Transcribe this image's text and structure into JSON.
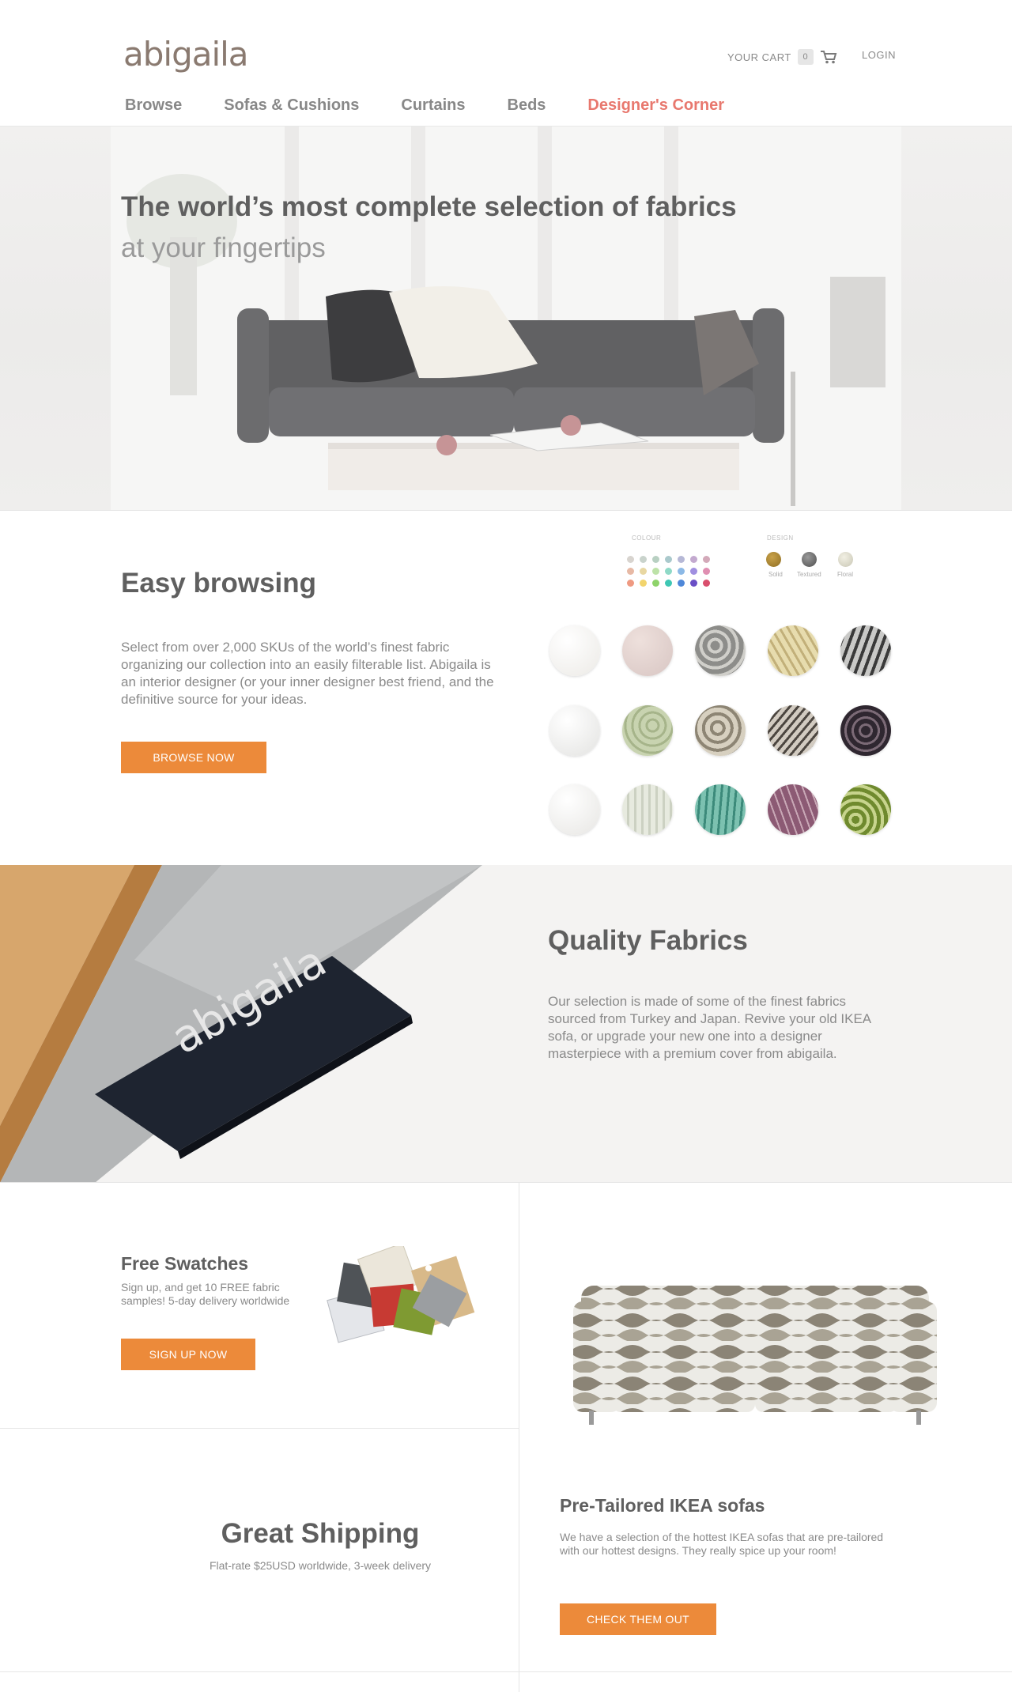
{
  "header": {
    "logo": "abigaila",
    "cart_label": "YOUR CART",
    "cart_count": "0",
    "login": "LOGIN",
    "nav": [
      "Browse",
      "Sofas & Cushions",
      "Curtains",
      "Beds",
      "Designer's Corner"
    ]
  },
  "hero": {
    "title": "The world’s most complete selection of fabrics",
    "subtitle": "at your fingertips"
  },
  "browse": {
    "title": "Easy browsing",
    "text": "Select from over 2,000 SKUs of the world’s finest fabric organizing our collection into an easily filterable list. Abigaila is an interior designer (or your inner designer best friend, and the definitive source for your ideas.",
    "button": "BROWSE NOW",
    "filter": {
      "colour_label": "COLOUR",
      "design_label": "DESIGN",
      "design_options": [
        "Solid",
        "Textured",
        "Floral"
      ]
    }
  },
  "quality": {
    "title": "Quality Fabrics",
    "text": "Our selection is made of some of the finest fabrics sourced from Turkey and Japan. Revive your old IKEA sofa, or upgrade your new one into a designer masterpiece with a premium cover from abigaila.",
    "label_logo": "abigaila"
  },
  "swatches": {
    "title": "Free Swatches",
    "text": "Sign up, and get 10 FREE fabric samples! 5-day delivery worldwide",
    "button": "SIGN UP NOW"
  },
  "shipping": {
    "title": "Great Shipping",
    "text": "Flat-rate $25USD worldwide, 3-week delivery"
  },
  "ikea": {
    "title": "Pre-Tailored IKEA sofas",
    "text": "We have a selection of the hottest IKEA sofas that are pre-tailored with our hottest designs. They really spice up your room!",
    "button": "CHECK THEM OUT"
  },
  "colors": {
    "accent_orange": "#ec8a3a",
    "accent_coral": "#e8786e"
  }
}
